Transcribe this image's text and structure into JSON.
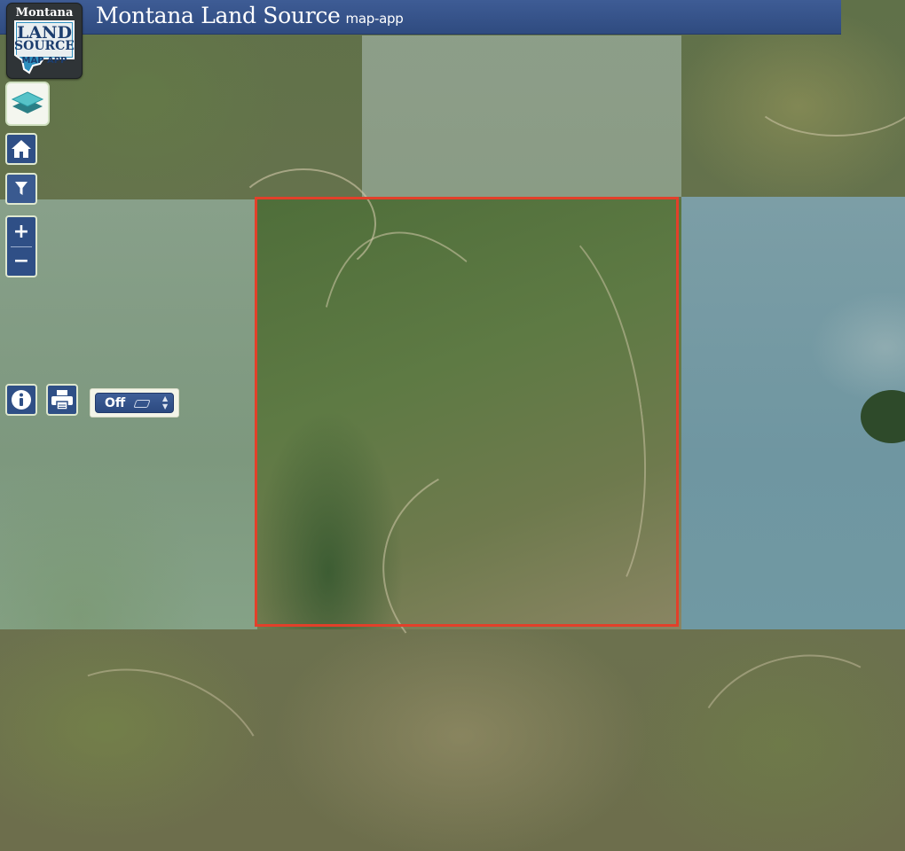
{
  "header": {
    "title": "Montana Land Source",
    "subtitle": "map-app"
  },
  "logo": {
    "line_top": "Montana",
    "line_1": "LAND",
    "line_2": "SOURCE",
    "line_3": "MAP APP"
  },
  "controls": {
    "layers_icon": "layers-icon",
    "home_icon": "home-icon",
    "filter_icon": "filter-icon",
    "zoom_in": "+",
    "zoom_out": "−",
    "info_icon": "info-icon",
    "print_icon": "printer-icon",
    "toggle_value": "Off",
    "toggle_icon": "eraser-icon"
  },
  "map": {
    "type": "satellite-imagery",
    "boundary_color": "#e2402a"
  },
  "colors": {
    "header": "#2f4b80",
    "control": "#2f4f86",
    "control_border": "#dfe8cf"
  }
}
